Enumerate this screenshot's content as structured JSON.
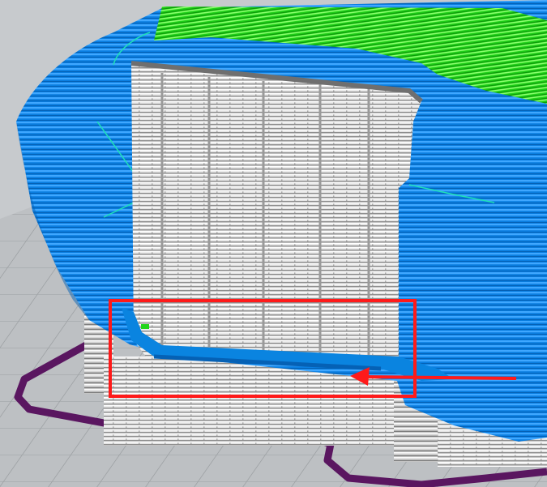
{
  "viewer": {
    "colors": {
      "background": "#c9cccf",
      "build_plate": "#b8bbbe",
      "grid_lines": "#9fa3a6",
      "outer_wall": "#0a84e0",
      "outer_wall_dark": "#0561b5",
      "outer_wall_light": "#3fa7ff",
      "inner_wall": "#1ee0b8",
      "top_skin": "#22d61a",
      "support": "#d9d9d9",
      "support_dark": "#8e8e8e",
      "skirt": "#5a1660",
      "annotation": "#ff1a1a"
    }
  },
  "annotation": {
    "type": "highlight-box-with-arrow",
    "color": "#ff1a1a"
  }
}
